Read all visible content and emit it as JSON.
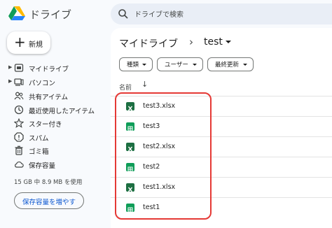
{
  "app": {
    "title": "ドライブ",
    "logo_icon": "google-drive-logo"
  },
  "search": {
    "placeholder": "ドライブで検索",
    "icon": "search-icon"
  },
  "new_button": {
    "label": "新規"
  },
  "sidebar": {
    "items": [
      {
        "label": "マイドライブ",
        "icon": "my-drive-icon",
        "expandable": true
      },
      {
        "label": "パソコン",
        "icon": "computer-icon",
        "expandable": true
      },
      {
        "label": "共有アイテム",
        "icon": "shared-icon",
        "expandable": false
      },
      {
        "label": "最近使用したアイテム",
        "icon": "clock-icon",
        "expandable": false
      },
      {
        "label": "スター付き",
        "icon": "star-icon",
        "expandable": false
      },
      {
        "label": "スパム",
        "icon": "spam-icon",
        "expandable": false
      },
      {
        "label": "ゴミ箱",
        "icon": "trash-icon",
        "expandable": false
      },
      {
        "label": "保存容量",
        "icon": "cloud-icon",
        "expandable": false
      }
    ],
    "storage_text": "15 GB 中 8.9 MB を使用",
    "storage_button": "保存容量を増やす"
  },
  "breadcrumb": {
    "root": "マイドライブ",
    "separator": "›",
    "current": "test"
  },
  "filters": [
    {
      "label": "種類"
    },
    {
      "label": "ユーザー"
    },
    {
      "label": "最終更新"
    }
  ],
  "list": {
    "column_name": "名前",
    "files": [
      {
        "name": "test3.xlsx",
        "type": "excel"
      },
      {
        "name": "test3",
        "type": "sheets"
      },
      {
        "name": "test2.xlsx",
        "type": "excel"
      },
      {
        "name": "test2",
        "type": "sheets"
      },
      {
        "name": "test1.xlsx",
        "type": "excel"
      },
      {
        "name": "test1",
        "type": "sheets"
      }
    ]
  },
  "colors": {
    "background": "#f8fafd",
    "main_surface": "#ffffff",
    "search_bg": "#e9eef6",
    "excel_green": "#1d6f42",
    "sheets_green": "#0f9d58",
    "highlight_red": "#e53935",
    "link_blue": "#0b57d0"
  }
}
